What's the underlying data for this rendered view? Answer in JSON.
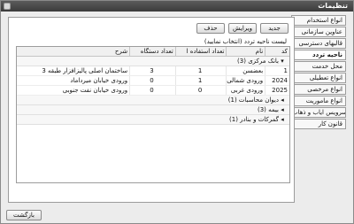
{
  "window": {
    "title": "تنظیمات"
  },
  "side_tabs": [
    {
      "label": "انواع استخدام",
      "active": false
    },
    {
      "label": "عناوین سازمانی",
      "active": false
    },
    {
      "label": "قالبهای دسترسی",
      "active": false
    },
    {
      "label": "ناحیه تردد",
      "active": true
    },
    {
      "label": "محل خدمت",
      "active": false
    },
    {
      "label": "انواع تعطیلی",
      "active": false
    },
    {
      "label": "انواع مرخصی",
      "active": false
    },
    {
      "label": "انواع ماموریت",
      "active": false
    },
    {
      "label": "سرویس ایاب و ذهاب",
      "active": false
    },
    {
      "label": "قانون کار",
      "active": false
    }
  ],
  "toolbar": {
    "new_label": "جدید",
    "edit_label": "ویرایش",
    "delete_label": "حذف"
  },
  "instruction": "لیست ناحیه تردد (انتخاب نمایید)",
  "grid": {
    "columns": {
      "code": "کد",
      "name": "نام",
      "count": "تعداد استفاده ا",
      "devices": "تعداد دستگاه",
      "description": "شرح"
    },
    "groups": [
      {
        "label": "بانک مرکزی (3)",
        "expanded": true,
        "rows": [
          {
            "code": "1",
            "name": "بعضسن",
            "count": "1",
            "devices": "3",
            "description": "ساختمان اصلی پالیزافزار طبقه 3"
          },
          {
            "code": "2024",
            "name": "ورودی شمالی",
            "count": "1",
            "devices": "0",
            "description": "ورودی خیابان میرداماد"
          },
          {
            "code": "2025",
            "name": "ورودی غربی",
            "count": "0",
            "devices": "0",
            "description": "ورودی خیابان نفت جنوبی"
          }
        ]
      },
      {
        "label": "دیوان محاسبات (1)",
        "expanded": false,
        "rows": []
      },
      {
        "label": "بیمه (3)",
        "expanded": false,
        "rows": []
      },
      {
        "label": "گمرکات و بنادر (1)",
        "expanded": false,
        "rows": []
      }
    ]
  },
  "footer": {
    "back_label": "بازگشت"
  }
}
